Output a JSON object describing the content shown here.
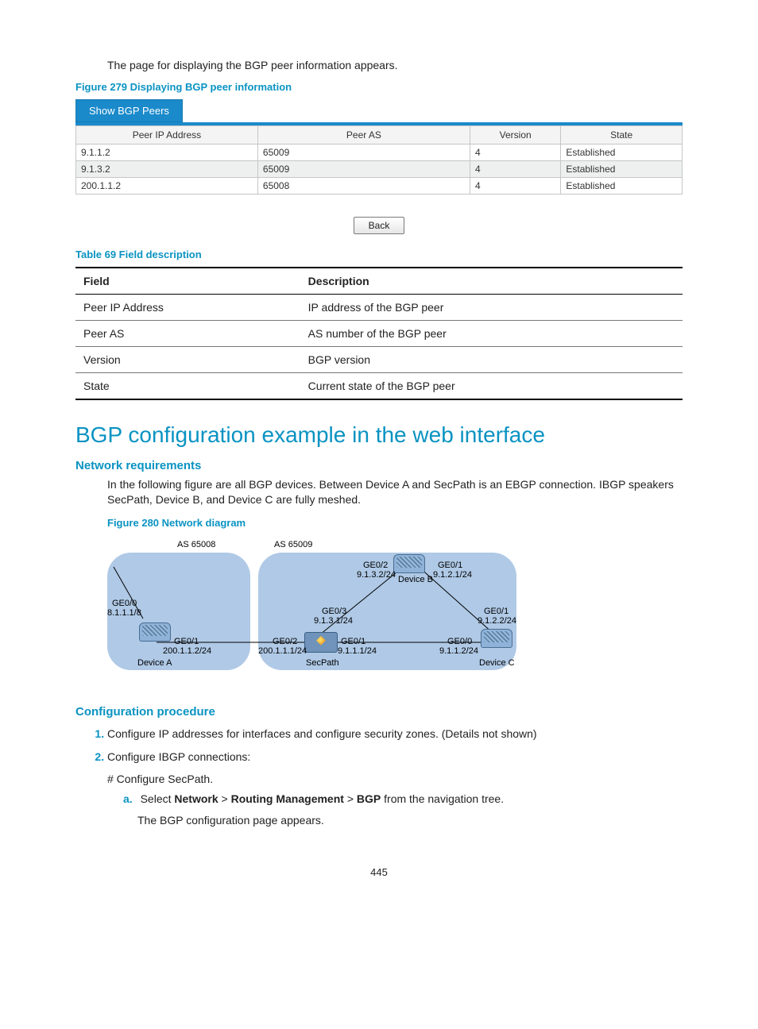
{
  "intro": "The page for displaying the BGP peer information appears.",
  "fig279_caption": "Figure 279 Displaying BGP peer information",
  "bgp_tab": "Show BGP Peers",
  "bgp_headers": {
    "col1": "Peer IP Address",
    "col2": "Peer AS",
    "col3": "Version",
    "col4": "State"
  },
  "bgp_rows": [
    {
      "ip": "9.1.1.2",
      "as": "65009",
      "ver": "4",
      "state": "Established"
    },
    {
      "ip": "9.1.3.2",
      "as": "65009",
      "ver": "4",
      "state": "Established"
    },
    {
      "ip": "200.1.1.2",
      "as": "65008",
      "ver": "4",
      "state": "Established"
    }
  ],
  "back_label": "Back",
  "table69_caption": "Table 69 Field description",
  "desc_headers": {
    "h1": "Field",
    "h2": "Description"
  },
  "desc_rows": [
    {
      "field": "Peer IP Address",
      "desc": "IP address of the BGP peer"
    },
    {
      "field": "Peer AS",
      "desc": "AS number of the BGP peer"
    },
    {
      "field": "Version",
      "desc": "BGP version"
    },
    {
      "field": "State",
      "desc": "Current state of the BGP peer"
    }
  ],
  "h1": "BGP configuration example in the web interface",
  "net_req_heading": "Network requirements",
  "net_req_para": "In the following figure are all BGP devices. Between Device A and SecPath is an EBGP connection. IBGP speakers SecPath, Device B, and Device C are fully meshed.",
  "fig280_caption": "Figure 280 Network diagram",
  "diagram": {
    "as_left": "AS 65008",
    "as_right": "AS 65009",
    "deviceA": "Device A",
    "deviceB": "Device B",
    "deviceC": "Device C",
    "secpath": "SecPath",
    "ge00": "GE0/0",
    "ge01": "GE0/1",
    "ge02": "GE0/2",
    "ge03": "GE0/3",
    "a_ge00_ip": "8.1.1.1/8",
    "a_ge01_ip": "200.1.1.2/24",
    "sp_ge02_ip": "200.1.1.1/24",
    "sp_ge01_ip": "9.1.1.1/24",
    "sp_ge03_ip": "9.1.3.1/24",
    "b_ge02_ip": "9.1.3.2/24",
    "b_ge01_ip": "9.1.2.1/24",
    "c_ge01_ip": "9.1.2.2/24",
    "c_ge00_ip": "9.1.1.2/24"
  },
  "cfg_heading": "Configuration procedure",
  "step1": "Configure IP addresses for interfaces and configure security zones. (Details not shown)",
  "step2": "Configure IBGP connections:",
  "step2_sub": "# Configure SecPath.",
  "step2a_prefix": "Select ",
  "step2a_network": "Network",
  "step2a_gt1": " > ",
  "step2a_routing": "Routing Management",
  "step2a_gt2": " > ",
  "step2a_bgp": "BGP",
  "step2a_suffix": " from the navigation tree.",
  "step2a_result": "The BGP configuration page appears.",
  "page_number": "445"
}
